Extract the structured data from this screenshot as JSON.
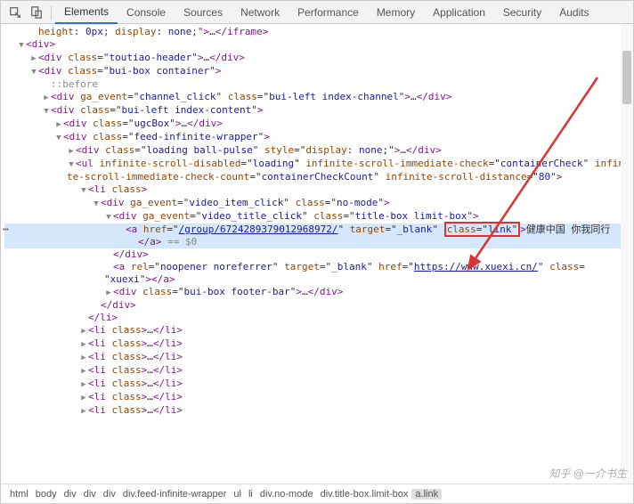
{
  "tabs": {
    "elements": "Elements",
    "console": "Console",
    "sources": "Sources",
    "network": "Network",
    "performance": "Performance",
    "memory": "Memory",
    "application": "Application",
    "security": "Security",
    "audits": "Audits"
  },
  "dom": {
    "l0": "height: 0px; display: none;\">…</iframe>",
    "l1_open": "<div>",
    "l2a": "<div class=\"toutiao-header\">…</div>",
    "l2b": "<div class=\"bui-box container\">",
    "l3_before": "::before",
    "l3a": "<div ga_event=\"channel_click\" class=\"bui-left index-channel\">…</div>",
    "l3b": "<div class=\"bui-left index-content\">",
    "l4a": "<div class=\"ugcBox\">…</div>",
    "l4b": "<div class=\"feed-infinite-wrapper\">",
    "l5a": "<div class=\"loading ball-pulse\" style=\"display: none;\">…</div>",
    "l5b_p1": "<ul infinite-scroll-disabled=\"loading\" infinite-scroll-immediate-check=\"containerCheck\"",
    "l5b_p2": "infinite-scroll-immediate-check-count=\"containerCheckCount\" infinite-scroll-distance=\"80\">",
    "l6a": "<li class>",
    "l7a": "<div ga_event=\"video_item_click\" class=\"no-mode\">",
    "l8a": "<div ga_event=\"video_title_click\" class=\"title-box limit-box\">",
    "l9_a_href": "/group/6724289379012968972/",
    "l9_a_target": "_blank",
    "l9_a_class_label": "class=\"link\"",
    "l9_a_text": "健康中国 你我同行",
    "l9_close": "</a>",
    "l9_eq": " == $0",
    "l8_close": "</div>",
    "l8b_p1": "<a rel=\"noopener noreferrer\" target=\"_blank\" href=\"https://www.xuexi.cn/\" class=",
    "l8b_p2": "\"xuexi\"></a>",
    "l8c": "<div class=\"bui-box footer-bar\">…</div>",
    "l7_close": "</div>",
    "l6_close": "</li>",
    "l6_li": "<li class>…</li>"
  },
  "crumbs": {
    "c0": "html",
    "c1": "body",
    "c2": "div",
    "c3": "div",
    "c4": "div",
    "c5": "div.feed-infinite-wrapper",
    "c6": "ul",
    "c7": "li",
    "c8": "div.no-mode",
    "c9": "div.title-box.limit-box",
    "c10": "a.link"
  },
  "watermark": "知乎 @一介书生"
}
